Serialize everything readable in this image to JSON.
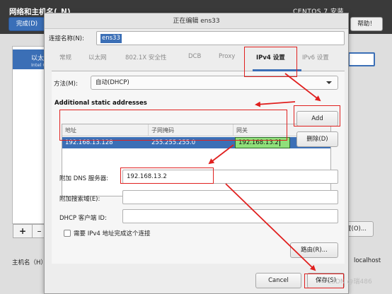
{
  "background": {
    "title": "网络和主机名(_N)",
    "product": "CENTOS 7 安装",
    "done_button": "完成(D)",
    "help_button": "帮助！",
    "device_label": "以太",
    "device_sublabel": "Intel C",
    "add_button": "+",
    "remove_button": "–",
    "configure_button": "置(O)...",
    "hostname_label": "主机名（H）",
    "hostname_value": "localhost"
  },
  "dialog": {
    "title": "正在编辑 ens33",
    "connection_name_label": "连接名称(N):",
    "connection_name_value": "ens33",
    "tabs": [
      {
        "label": "常规"
      },
      {
        "label": "以太网"
      },
      {
        "label": "802.1X 安全性"
      },
      {
        "label": "DCB"
      },
      {
        "label": "Proxy"
      },
      {
        "label": "IPv4 设置",
        "active": true
      },
      {
        "label": "IPv6 设置"
      }
    ],
    "method_label": "方法(M):",
    "method_value": "自动(DHCP)",
    "addresses_title": "Additional static addresses",
    "table": {
      "columns": [
        "地址",
        "子网掩码",
        "网关"
      ],
      "rows": [
        {
          "address": "192.168.13.128",
          "netmask": "255.255.255.0",
          "gateway": "192.168.13.2"
        }
      ]
    },
    "add_button": "Add",
    "delete_button": "删除(D)",
    "dns_label": "附加 DNS 服务器:",
    "dns_value": "192.168.13.2",
    "search_label": "附加搜索域(E):",
    "search_value": "",
    "dhcp_client_label": "DHCP 客户端 ID:",
    "dhcp_client_value": "",
    "require_ipv4_label": "需要 IPv4 地址完成这个连接",
    "require_ipv4_checked": false,
    "routes_button": "路由(R)...",
    "cancel_button": "Cancel",
    "save_button": "保存(S)"
  },
  "watermark": "CSDN @瑞486",
  "colors": {
    "accent": "#3b6fb6",
    "annotation": "#e0201f",
    "edit_cell": "#8fe07a"
  }
}
